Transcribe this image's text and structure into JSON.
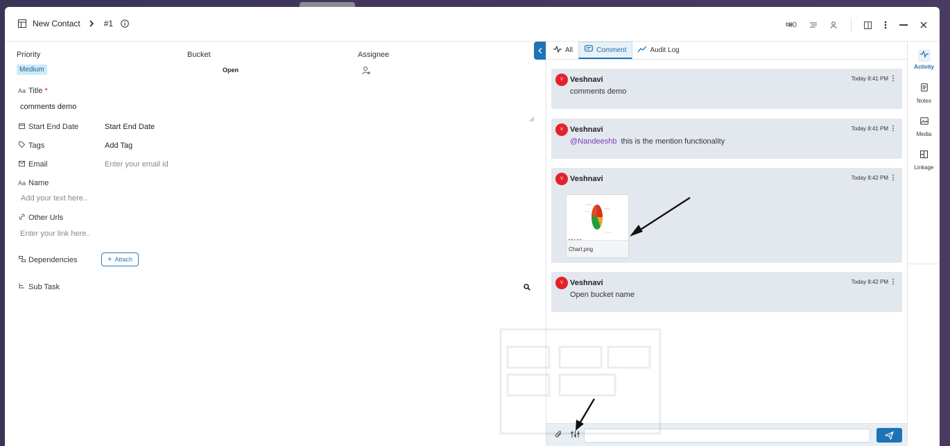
{
  "header": {
    "title": "New Contact",
    "record_id": "#1",
    "subtask_count": "0"
  },
  "fields": {
    "priority_label": "Priority",
    "priority_value": "Medium",
    "bucket_label": "Bucket",
    "bucket_value": "Open",
    "assignee_label": "Assignee",
    "title_label": "Title",
    "title_required": "*",
    "title_value": "comments demo",
    "start_end_label": "Start End Date",
    "start_end_value": "Start End Date",
    "tags_label": "Tags",
    "tags_value": "Add Tag",
    "email_label": "Email",
    "email_placeholder": "Enter your email id",
    "name_label": "Name",
    "name_placeholder": "Add your text here..",
    "urls_label": "Other Urls",
    "urls_placeholder": "Enter your link here..",
    "dependencies_label": "Dependencies",
    "attach_label": "Attach",
    "subtask_label": "Sub Task"
  },
  "tabs": [
    {
      "label": "All"
    },
    {
      "label": "Comment"
    },
    {
      "label": "Audit Log"
    }
  ],
  "comments": [
    {
      "user": "Veshnavi",
      "avatar": "V",
      "time": "Today 8:41 PM",
      "text": "comments demo"
    },
    {
      "user": "Veshnavi",
      "avatar": "V",
      "time": "Today 8:41 PM",
      "mention": "@Nandeeshb",
      "text": "this is the mention functionality"
    },
    {
      "user": "Veshnavi",
      "avatar": "V",
      "time": "Today 8:42 PM",
      "attachment": "Chart.png"
    },
    {
      "user": "Veshnavi",
      "avatar": "V",
      "time": "Today 8:42 PM",
      "text": "Open bucket name"
    }
  ],
  "rail": [
    {
      "label": "Activity",
      "icon": "activity-icon"
    },
    {
      "label": "Notes",
      "icon": "notes-icon"
    },
    {
      "label": "Media",
      "icon": "media-icon"
    },
    {
      "label": "Linkage",
      "icon": "linkage-icon"
    }
  ],
  "colors": {
    "accent": "#1d73b6",
    "avatar": "#e2232b",
    "card_bg": "#e3e8ef",
    "mention": "#7a3bb5"
  }
}
